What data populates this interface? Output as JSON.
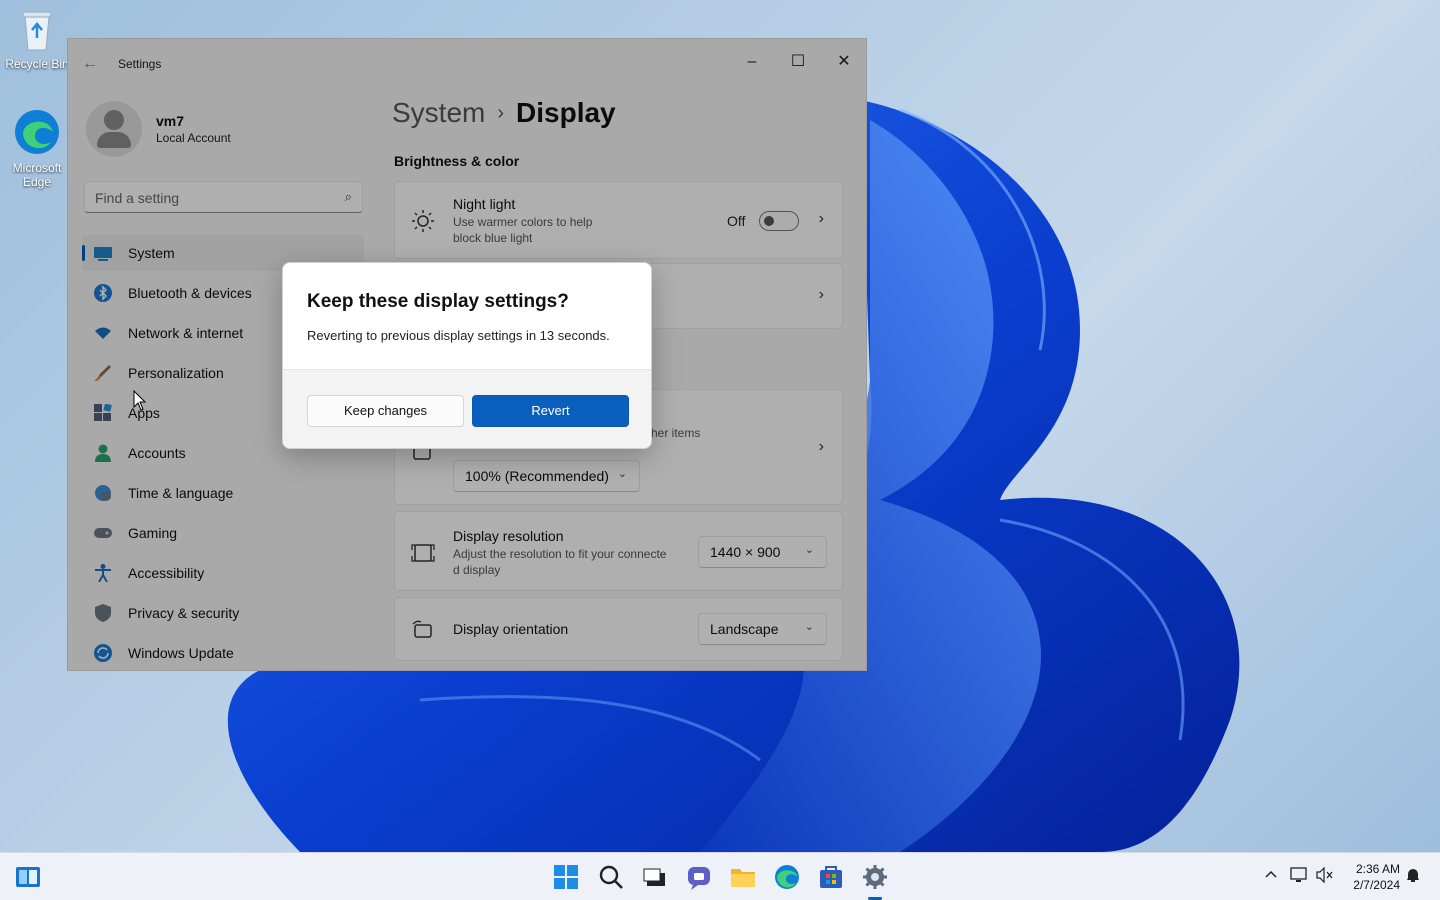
{
  "desktop": {
    "icons": [
      {
        "label": "Recycle Bin",
        "icon": "recycle-bin-icon"
      },
      {
        "label": "Microsoft Edge",
        "icon": "edge-icon"
      }
    ]
  },
  "window": {
    "title": "Settings",
    "controls": [
      "minimize",
      "maximize",
      "close"
    ]
  },
  "profile": {
    "name": "vm7",
    "account_type": "Local Account"
  },
  "search": {
    "placeholder": "Find a setting"
  },
  "nav": {
    "items": [
      {
        "label": "System",
        "icon": "system-icon",
        "active": true
      },
      {
        "label": "Bluetooth & devices",
        "icon": "bluetooth-icon"
      },
      {
        "label": "Network & internet",
        "icon": "wifi-icon"
      },
      {
        "label": "Personalization",
        "icon": "brush-icon"
      },
      {
        "label": "Apps",
        "icon": "apps-icon"
      },
      {
        "label": "Accounts",
        "icon": "accounts-icon"
      },
      {
        "label": "Time & language",
        "icon": "globe-clock-icon"
      },
      {
        "label": "Gaming",
        "icon": "gamepad-icon"
      },
      {
        "label": "Accessibility",
        "icon": "accessibility-icon"
      },
      {
        "label": "Privacy & security",
        "icon": "shield-icon"
      },
      {
        "label": "Windows Update",
        "icon": "update-icon"
      }
    ]
  },
  "content": {
    "breadcrumb_parent": "System",
    "breadcrumb_separator": "›",
    "breadcrumb_current": "Display",
    "section_label": "Brightness & color",
    "night_light": {
      "title": "Night light",
      "subtitle_line1": "Use warmer colors to help",
      "subtitle_line2": "block blue light",
      "state": "Off"
    },
    "scale": {
      "partial_text": "her items",
      "value": "100% (Recommended)"
    },
    "resolution": {
      "title": "Display resolution",
      "subtitle_line1": "Adjust the resolution to fit your connecte",
      "subtitle_line2": "d display",
      "value": "1440 × 900"
    },
    "orientation": {
      "title": "Display orientation",
      "value": "Landscape"
    }
  },
  "dialog": {
    "title": "Keep these display settings?",
    "message": "Reverting to previous display settings in 13 seconds.",
    "keep_label": "Keep changes",
    "revert_label": "Revert",
    "accent": "#0a5fbd"
  },
  "taskbar": {
    "apps": [
      "widgets-icon",
      "start-icon",
      "search-icon",
      "task-view-icon",
      "chat-icon",
      "file-explorer-icon",
      "edge-icon",
      "store-icon",
      "settings-icon"
    ],
    "time": "2:36 AM",
    "date": "2/7/2024"
  }
}
